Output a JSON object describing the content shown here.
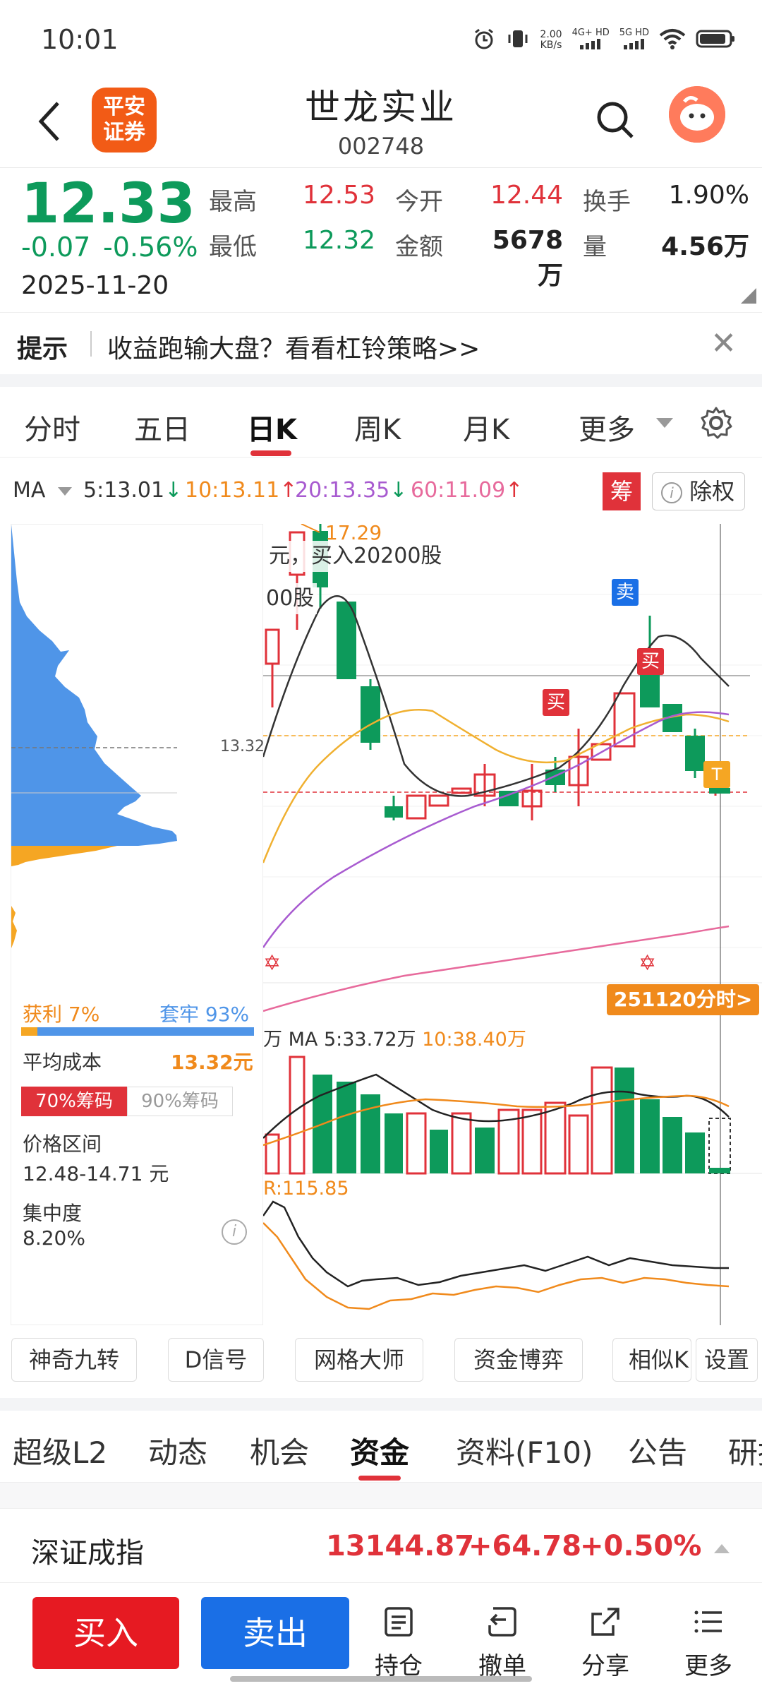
{
  "status_bar": {
    "time": "10:01",
    "net_speed_value": "2.00",
    "net_speed_unit": "KB/s",
    "sim1": "4G+ HD",
    "sim2": "5G HD"
  },
  "header": {
    "broker_logo_line1": "平安",
    "broker_logo_line2": "证券",
    "stock_name": "世龙实业",
    "stock_code": "002748"
  },
  "quote": {
    "price": "12.33",
    "change_abs": "-0.07",
    "change_pct": "-0.56%",
    "date": "2025-11-20",
    "fields": [
      {
        "label": "最高",
        "value": "12.53",
        "color": "#e0323a"
      },
      {
        "label": "今开",
        "value": "12.44",
        "color": "#e0323a"
      },
      {
        "label": "换手",
        "value": "1.90%",
        "color": "#222222"
      },
      {
        "label": "最低",
        "value": "12.32",
        "color": "#0d9a5b"
      },
      {
        "label": "金额",
        "value": "5678万",
        "color": "#222222"
      },
      {
        "label": "量",
        "value": "4.56万",
        "color": "#222222"
      }
    ]
  },
  "tip": {
    "label": "提示",
    "text": "收益跑输大盘？看看杠铃策略>>"
  },
  "period_tabs": [
    "分时",
    "五日",
    "日K",
    "周K",
    "月K",
    "更多"
  ],
  "ma": {
    "label": "MA",
    "ma5": "5:13.01",
    "ma10": "10:13.11",
    "ma20": "20:13.35",
    "ma60": "60:11.09",
    "chip_button": "筹",
    "exright_button": "除权"
  },
  "chip_panel": {
    "price_marker": "13.32",
    "profit_label": "获利 7%",
    "trapped_label": "套牢 93%",
    "profit_fraction": 0.07,
    "avg_cost_label": "平均成本",
    "avg_cost_value": "13.32元",
    "tab_70": "70%筹码",
    "tab_90": "90%筹码",
    "range_label": "价格区间",
    "range_value": "12.48-14.71 元",
    "concentration_label": "集中度",
    "concentration_value": "8.20%"
  },
  "kchart": {
    "high_label": "17.29",
    "trade_note1": "元，买入20200股",
    "trade_note2": "00股",
    "sell_tag": "卖",
    "buy_tag": "买",
    "t_tag": "T",
    "intraday_button": "251120分时>",
    "vol_ma_label": "MA 5:33.72万",
    "vol_ma10_label": "10:38.40万",
    "vol_ma_prefix": "万",
    "indicator_label": "R:115.85"
  },
  "tools": [
    "神奇九转",
    "D信号",
    "网格大师",
    "资金博弈",
    "相似K",
    "设置"
  ],
  "section_tabs": [
    "超级L2",
    "动态",
    "机会",
    "资金",
    "资料(F10)",
    "公告",
    "研报"
  ],
  "index_bar": {
    "name": "深证成指",
    "value": "13144.87",
    "change": "+64.78",
    "pct": "+0.50%"
  },
  "bottom_bar": {
    "buy": "买入",
    "sell": "卖出",
    "items": [
      "持仓",
      "撤单",
      "分享",
      "更多"
    ]
  }
}
